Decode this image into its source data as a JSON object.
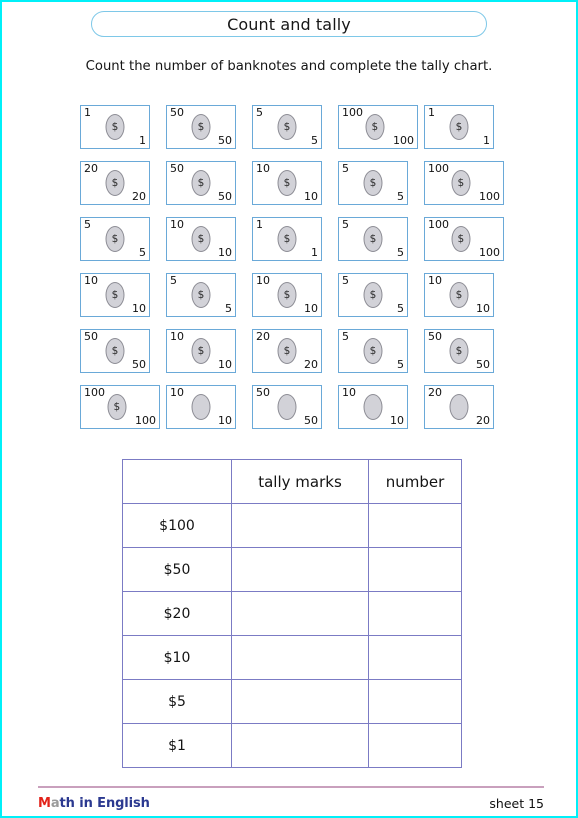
{
  "page": {
    "border_color": "#00f0f8",
    "title": "Count and tally",
    "instruction": "Count the number of banknotes and complete the tally chart."
  },
  "banknotes": {
    "symbol": "$",
    "rows": [
      [
        {
          "value": "1",
          "has_symbol": true
        },
        {
          "value": "50",
          "has_symbol": true
        },
        {
          "value": "5",
          "has_symbol": true
        },
        {
          "value": "100",
          "has_symbol": true
        },
        {
          "value": "1",
          "has_symbol": true
        }
      ],
      [
        {
          "value": "20",
          "has_symbol": true
        },
        {
          "value": "50",
          "has_symbol": true
        },
        {
          "value": "10",
          "has_symbol": true
        },
        {
          "value": "5",
          "has_symbol": true
        },
        {
          "value": "100",
          "has_symbol": true
        }
      ],
      [
        {
          "value": "5",
          "has_symbol": true
        },
        {
          "value": "10",
          "has_symbol": true
        },
        {
          "value": "1",
          "has_symbol": true
        },
        {
          "value": "5",
          "has_symbol": true
        },
        {
          "value": "100",
          "has_symbol": true
        }
      ],
      [
        {
          "value": "10",
          "has_symbol": true
        },
        {
          "value": "5",
          "has_symbol": true
        },
        {
          "value": "10",
          "has_symbol": true
        },
        {
          "value": "5",
          "has_symbol": true
        },
        {
          "value": "10",
          "has_symbol": true
        }
      ],
      [
        {
          "value": "50",
          "has_symbol": true
        },
        {
          "value": "10",
          "has_symbol": true
        },
        {
          "value": "20",
          "has_symbol": true
        },
        {
          "value": "5",
          "has_symbol": true
        },
        {
          "value": "50",
          "has_symbol": true
        }
      ],
      [
        {
          "value": "100",
          "has_symbol": true
        },
        {
          "value": "10",
          "has_symbol": false
        },
        {
          "value": "50",
          "has_symbol": false
        },
        {
          "value": "10",
          "has_symbol": false
        },
        {
          "value": "20",
          "has_symbol": false
        }
      ]
    ]
  },
  "tally_chart": {
    "headers": [
      "",
      "tally marks",
      "number"
    ],
    "rows": [
      {
        "label": "$100",
        "tally": "",
        "number": ""
      },
      {
        "label": "$50",
        "tally": "",
        "number": ""
      },
      {
        "label": "$20",
        "tally": "",
        "number": ""
      },
      {
        "label": "$10",
        "tally": "",
        "number": ""
      },
      {
        "label": "$5",
        "tally": "",
        "number": ""
      },
      {
        "label": "$1",
        "tally": "",
        "number": ""
      }
    ]
  },
  "footer": {
    "logo_m": "M",
    "logo_a": "a",
    "logo_rest": "th in English",
    "sheet": "sheet 15"
  }
}
